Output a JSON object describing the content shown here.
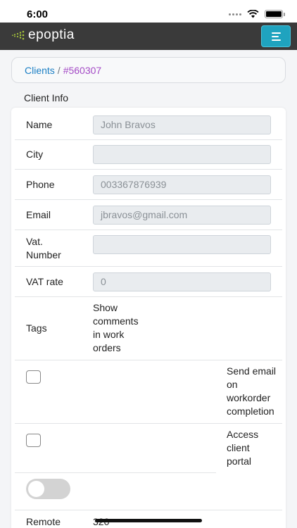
{
  "status": {
    "time": "6:00"
  },
  "navbar": {
    "brand": "epoptia"
  },
  "breadcrumb": {
    "parent": "Clients",
    "separator": "/",
    "current": "#560307"
  },
  "section": {
    "title": "Client Info"
  },
  "fields": {
    "name": {
      "label": "Name",
      "value": "John Bravos"
    },
    "city": {
      "label": "City",
      "value": ""
    },
    "phone": {
      "label": "Phone",
      "value": "003367876939"
    },
    "email": {
      "label": "Email",
      "value": "jbravos@gmail.com"
    },
    "vat_number": {
      "label_line1": "Vat.",
      "label_line2": "Number",
      "value": ""
    },
    "vat_rate": {
      "label": "VAT rate",
      "value": "0"
    }
  },
  "tags": {
    "label": "Tags",
    "show_comments": [
      "Show",
      "comments",
      "in work",
      "orders"
    ]
  },
  "options": {
    "send_email": [
      "Send email",
      "on",
      "workorder",
      "completion"
    ],
    "client_portal": [
      "Access",
      "client",
      "portal"
    ]
  },
  "remote": {
    "label": "Remote",
    "value": "320"
  },
  "colors": {
    "navbar": "#3a3a3a",
    "accent": "#1fa3bf",
    "link": "#1b7fc4",
    "active": "#a44bc6"
  }
}
